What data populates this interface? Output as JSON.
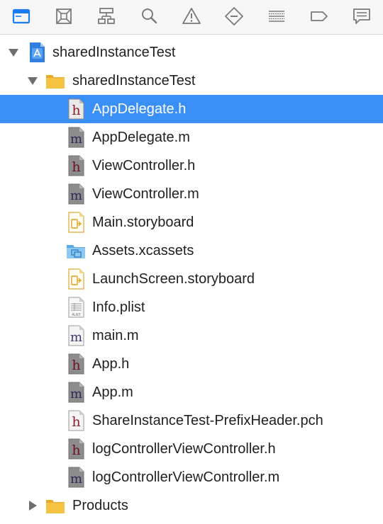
{
  "toolbar": {
    "buttons": [
      {
        "name": "project-navigator-icon",
        "active": true
      },
      {
        "name": "source-control-navigator-icon"
      },
      {
        "name": "symbol-navigator-icon"
      },
      {
        "name": "find-navigator-icon"
      },
      {
        "name": "issue-navigator-icon"
      },
      {
        "name": "test-navigator-icon"
      },
      {
        "name": "debug-navigator-icon"
      },
      {
        "name": "breakpoint-navigator-icon"
      },
      {
        "name": "report-navigator-icon"
      }
    ],
    "accent_color": "#1a7cf5"
  },
  "tree": {
    "project": {
      "label": "sharedInstanceTest",
      "icon": "xcode-project-icon",
      "expanded": true
    },
    "group": {
      "label": "sharedInstanceTest",
      "icon": "folder-icon",
      "expanded": true
    },
    "files": [
      {
        "label": "AppDelegate.h",
        "icon": "header-file-icon",
        "selected": true
      },
      {
        "label": "AppDelegate.m",
        "icon": "implementation-file-icon"
      },
      {
        "label": "ViewController.h",
        "icon": "header-file-icon"
      },
      {
        "label": "ViewController.m",
        "icon": "implementation-file-icon"
      },
      {
        "label": "Main.storyboard",
        "icon": "storyboard-file-icon"
      },
      {
        "label": "Assets.xcassets",
        "icon": "asset-catalog-icon"
      },
      {
        "label": "LaunchScreen.storyboard",
        "icon": "storyboard-file-icon"
      },
      {
        "label": "Info.plist",
        "icon": "plist-file-icon",
        "badge": "PLIST"
      },
      {
        "label": "main.m",
        "icon": "implementation-file-icon"
      },
      {
        "label": "App.h",
        "icon": "header-file-icon"
      },
      {
        "label": "App.m",
        "icon": "implementation-file-icon"
      },
      {
        "label": "ShareInstanceTest-PrefixHeader.pch",
        "icon": "pch-file-icon"
      },
      {
        "label": "logControllerViewController.h",
        "icon": "header-file-icon"
      },
      {
        "label": "logControllerViewController.m",
        "icon": "implementation-file-icon"
      }
    ],
    "products": {
      "label": "Products",
      "icon": "folder-icon",
      "expanded": false
    }
  },
  "colors": {
    "selection": "#3a8ff6",
    "folder": "#f6c341",
    "header_letter": "#8e1d2a",
    "impl_letter": "#3c3a72"
  }
}
